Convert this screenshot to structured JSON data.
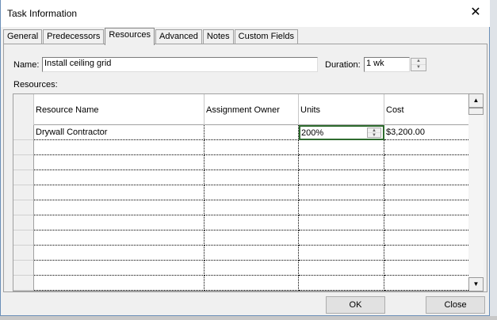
{
  "title": "Task Information",
  "tabs": [
    "General",
    "Predecessors",
    "Resources",
    "Advanced",
    "Notes",
    "Custom Fields"
  ],
  "active_tab": "Resources",
  "name_label": "Name:",
  "name_value": "Install ceiling grid",
  "duration_label": "Duration:",
  "duration_value": "1 wk",
  "resources_label": "Resources:",
  "columns": [
    "Resource Name",
    "Assignment Owner",
    "Units",
    "Cost"
  ],
  "rows": [
    {
      "name": "Drywall Contractor",
      "owner": "",
      "units": "200%",
      "cost": "$3,200.00"
    }
  ],
  "empty_rows": 10,
  "ok_label": "OK",
  "close_label": "Close",
  "selected_border": "#2e6b2e"
}
